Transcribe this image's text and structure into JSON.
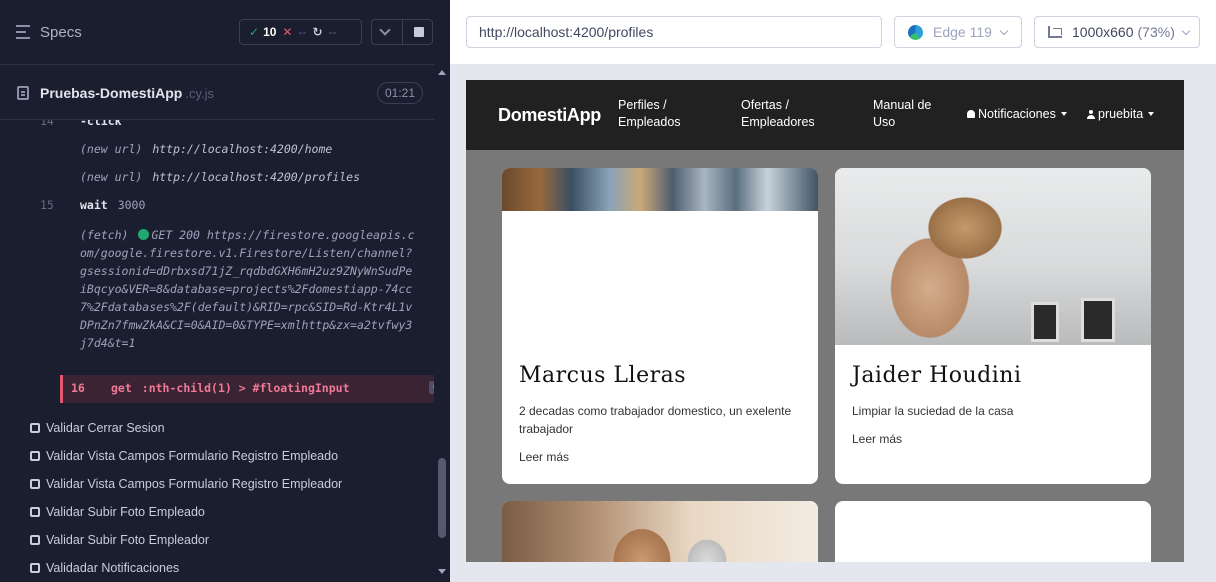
{
  "runner": {
    "specs_title": "Specs",
    "stats": {
      "passed": "10",
      "failed": "--",
      "pending": "--"
    },
    "spec_file": {
      "name": "Pruebas-DomestiApp",
      "ext": ".cy.js",
      "duration": "01:21"
    },
    "commands": [
      {
        "num": "14",
        "name": "-click"
      },
      {
        "sub_label": "(new url)",
        "url": "http://localhost:4200/home"
      },
      {
        "sub_label": "(new url)",
        "url": "http://localhost:4200/profiles"
      },
      {
        "num": "15",
        "name": "wait",
        "arg": "3000"
      }
    ],
    "fetch": {
      "label": "(fetch)",
      "method": "GET 200",
      "url": "https://firestore.googleapis.com/google.firestore.v1.Firestore/Listen/channel?gsessionid=dDrbxsd71jZ_rqdbdGXH6mH2uz9ZNyWnSudPeiBqcyo&VER=8&database=projects%2Fdomestiapp-74cc7%2Fdatabases%2F(default)&RID=rpc&SID=Rd-Ktr4L1vDPnZn7fmwZkA&CI=0&AID=0&TYPE=xmlhttp&zx=a2tvfwy3j7d4&t=1"
    },
    "pending_command": {
      "num": "16",
      "name": "get",
      "arg": ":nth-child(1) > #floatingInput",
      "count": "0"
    },
    "tests": [
      "Validar Cerrar Sesion",
      "Validar Vista Campos Formulario Registro Empleado",
      "Validar Vista Campos Formulario Registro Empleador",
      "Validar Subir Foto Empleado",
      "Validar Subir Foto Empleador",
      "Validadar Notificaciones"
    ]
  },
  "browser": {
    "url": "http://localhost:4200/profiles",
    "browser_name": "Edge 119",
    "viewport": "1000x660",
    "scale": "(73%)"
  },
  "app": {
    "brand": "DomestiApp",
    "nav": {
      "profiles": [
        "Perfiles /",
        "Empleados"
      ],
      "offers": [
        "Ofertas /",
        "Empleadores"
      ],
      "manual": [
        "Manual de",
        "Uso"
      ],
      "notifications": "Notificaciones",
      "user": "pruebita"
    },
    "cards": [
      {
        "name": "Marcus Lleras",
        "desc": "2 decadas como trabajador domestico, un exelente trabajador",
        "link": "Leer más"
      },
      {
        "name": "Jaider Houdini",
        "desc": "Limpiar la suciedad de la casa",
        "link": "Leer más"
      }
    ]
  },
  "colors": {
    "runner_bg": "#1b1e2e",
    "pass_green": "#1fa971",
    "fail_red": "#e45770",
    "app_nav_bg": "#212121",
    "app_bg": "#787878"
  }
}
